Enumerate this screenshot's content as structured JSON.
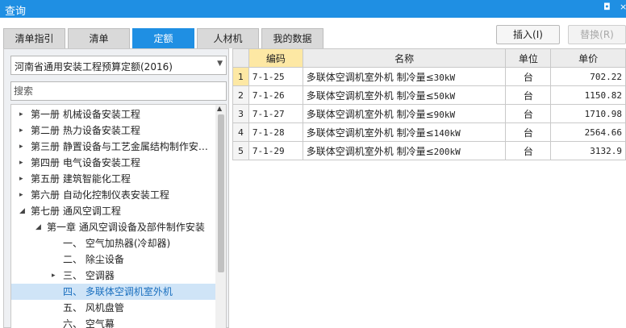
{
  "window": {
    "title": "查询",
    "restore_glyph": "◘",
    "close_glyph": "×"
  },
  "tabs": [
    {
      "label": "清单指引",
      "active": false
    },
    {
      "label": "清单",
      "active": false
    },
    {
      "label": "定额",
      "active": true
    },
    {
      "label": "人材机",
      "active": false
    },
    {
      "label": "我的数据",
      "active": false
    }
  ],
  "toolbar": {
    "insert_label": "插入(I)",
    "replace_label": "替换(R)"
  },
  "quota_dropdown": {
    "value": "河南省通用安装工程预算定额(2016)"
  },
  "search": {
    "placeholder": "搜索",
    "value": ""
  },
  "tree": [
    {
      "label": "第一册 机械设备安装工程",
      "level": 0,
      "toggle": "▸",
      "selected": false
    },
    {
      "label": "第二册 热力设备安装工程",
      "level": 0,
      "toggle": "▸",
      "selected": false
    },
    {
      "label": "第三册 静置设备与工艺金属结构制作安…",
      "level": 0,
      "toggle": "▸",
      "selected": false
    },
    {
      "label": "第四册 电气设备安装工程",
      "level": 0,
      "toggle": "▸",
      "selected": false
    },
    {
      "label": "第五册 建筑智能化工程",
      "level": 0,
      "toggle": "▸",
      "selected": false
    },
    {
      "label": "第六册 自动化控制仪表安装工程",
      "level": 0,
      "toggle": "▸",
      "selected": false
    },
    {
      "label": "第七册 通风空调工程",
      "level": 0,
      "toggle": "◢",
      "selected": false
    },
    {
      "label": "第一章 通风空调设备及部件制作安装",
      "level": 1,
      "toggle": "◢",
      "selected": false
    },
    {
      "label": "一、 空气加热器(冷却器)",
      "level": 2,
      "toggle": "",
      "selected": false
    },
    {
      "label": "二、 除尘设备",
      "level": 2,
      "toggle": "",
      "selected": false
    },
    {
      "label": "三、 空调器",
      "level": 2,
      "toggle": "▸",
      "selected": false
    },
    {
      "label": "四、 多联体空调机室外机",
      "level": 2,
      "toggle": "",
      "selected": true
    },
    {
      "label": "五、 风机盘管",
      "level": 2,
      "toggle": "",
      "selected": false
    },
    {
      "label": "六、 空气幕",
      "level": 2,
      "toggle": "",
      "selected": false
    }
  ],
  "table": {
    "columns": [
      "编码",
      "名称",
      "单位",
      "单价"
    ],
    "rows": [
      {
        "index": "1",
        "code": "7-1-25",
        "name": "多联体空调机室外机 制冷量≤",
        "spec": "30kW",
        "unit": "台",
        "price": "702.22"
      },
      {
        "index": "2",
        "code": "7-1-26",
        "name": "多联体空调机室外机 制冷量≤",
        "spec": "50kW",
        "unit": "台",
        "price": "1150.82"
      },
      {
        "index": "3",
        "code": "7-1-27",
        "name": "多联体空调机室外机 制冷量≤",
        "spec": "90kW",
        "unit": "台",
        "price": "1710.98"
      },
      {
        "index": "4",
        "code": "7-1-28",
        "name": "多联体空调机室外机 制冷量≤",
        "spec": "140kW",
        "unit": "台",
        "price": "2564.66"
      },
      {
        "index": "5",
        "code": "7-1-29",
        "name": "多联体空调机室外机 制冷量≤",
        "spec": "200kW",
        "unit": "台",
        "price": "3132.9"
      }
    ]
  },
  "colors": {
    "accent": "#1f8fe3",
    "selected_row": "#cfe4f7",
    "code_header": "#fde8a4"
  }
}
